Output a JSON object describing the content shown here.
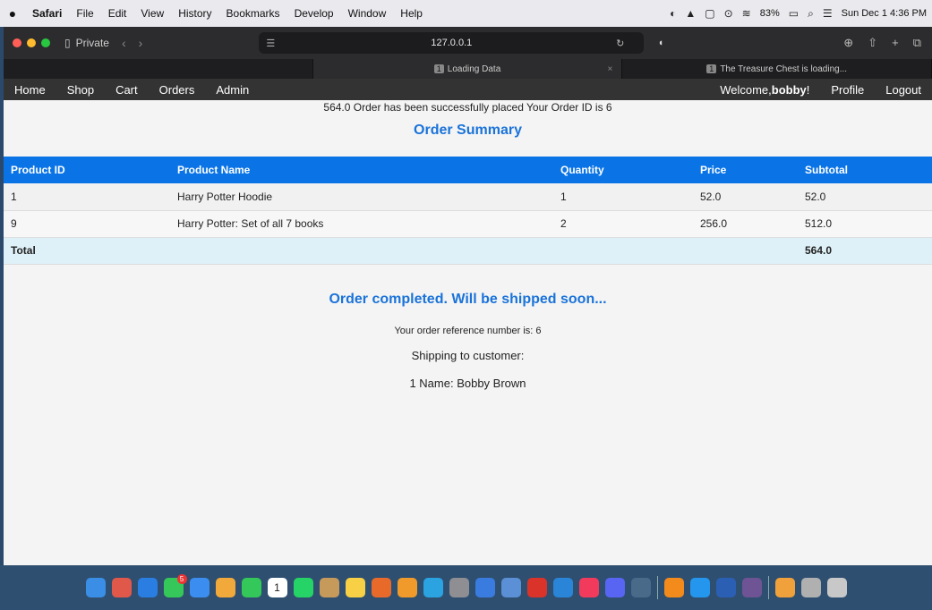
{
  "menubar": {
    "app": "Safari",
    "items": [
      "File",
      "Edit",
      "View",
      "History",
      "Bookmarks",
      "Develop",
      "Window",
      "Help"
    ],
    "battery": "83%",
    "datetime": "Sun Dec 1  4:36 PM"
  },
  "browser": {
    "private_label": "Private",
    "url": "127.0.0.1",
    "tabs": [
      {
        "label": "Loading Data",
        "num": "1"
      },
      {
        "label": "The Treasure Chest is loading...",
        "num": "1"
      }
    ]
  },
  "appnav": {
    "left": [
      "Home",
      "Shop",
      "Cart",
      "Orders",
      "Admin"
    ],
    "welcome_prefix": "Welcome,",
    "username": "bobby",
    "welcome_suffix": "!",
    "profile": "Profile",
    "logout": "Logout"
  },
  "page": {
    "flash": "564.0 Order has been successfully placed Your Order ID is 6",
    "summary_title": "Order Summary",
    "columns": [
      "Product ID",
      "Product Name",
      "Quantity",
      "Price",
      "Subtotal"
    ],
    "rows": [
      [
        "1",
        "Harry Potter Hoodie",
        "1",
        "52.0",
        "52.0"
      ],
      [
        "9",
        "Harry Potter: Set of all 7 books",
        "2",
        "256.0",
        "512.0"
      ]
    ],
    "total_label": "Total",
    "total_value": "564.0",
    "completed": "Order completed. Will be shipped soon...",
    "reference": "Your order reference number is: 6",
    "shipping": "Shipping to customer:",
    "customer": "1 Name: Bobby Brown"
  },
  "dock": {
    "icons": [
      {
        "name": "finder-icon",
        "color": "#3a8ee6"
      },
      {
        "name": "launchpad-icon",
        "color": "#e0584a"
      },
      {
        "name": "safari-icon",
        "color": "#2a7de1"
      },
      {
        "name": "messages-icon",
        "color": "#35c759"
      },
      {
        "name": "mail-icon",
        "color": "#3b8ef0"
      },
      {
        "name": "photos-icon",
        "color": "#f2a93b"
      },
      {
        "name": "facetime-icon",
        "color": "#34c759"
      },
      {
        "name": "calendar-icon",
        "color": "#ffffff"
      },
      {
        "name": "whatsapp-icon",
        "color": "#25d366"
      },
      {
        "name": "contacts-icon",
        "color": "#c69a5b"
      },
      {
        "name": "notes-icon",
        "color": "#f7d046"
      },
      {
        "name": "matlab-icon",
        "color": "#e86a2b"
      },
      {
        "name": "sublime-icon",
        "color": "#f09a2b"
      },
      {
        "name": "telegram-icon",
        "color": "#2aa3e0"
      },
      {
        "name": "settings-icon",
        "color": "#8e8e93"
      },
      {
        "name": "proxyman-icon",
        "color": "#3a7be0"
      },
      {
        "name": "preview-icon",
        "color": "#5b8fd6"
      },
      {
        "name": "acrobat-icon",
        "color": "#d9332a"
      },
      {
        "name": "vscode-icon",
        "color": "#2a84d8"
      },
      {
        "name": "music-icon",
        "color": "#f23b5c"
      },
      {
        "name": "discord-icon",
        "color": "#5865f2"
      },
      {
        "name": "preview2-icon",
        "color": "#4a6a8a"
      },
      {
        "name": "vlc-icon",
        "color": "#f28a1c"
      },
      {
        "name": "docker-icon",
        "color": "#2496ed"
      },
      {
        "name": "word-icon",
        "color": "#2b5fb3"
      },
      {
        "name": "github-icon",
        "color": "#6e5494"
      },
      {
        "name": "installer-icon",
        "color": "#f0a13b"
      },
      {
        "name": "help-icon",
        "color": "#b0b0b0"
      },
      {
        "name": "trash-icon",
        "color": "#c8c8c8"
      }
    ],
    "messages_badge": "5",
    "calendar_day": "1"
  }
}
